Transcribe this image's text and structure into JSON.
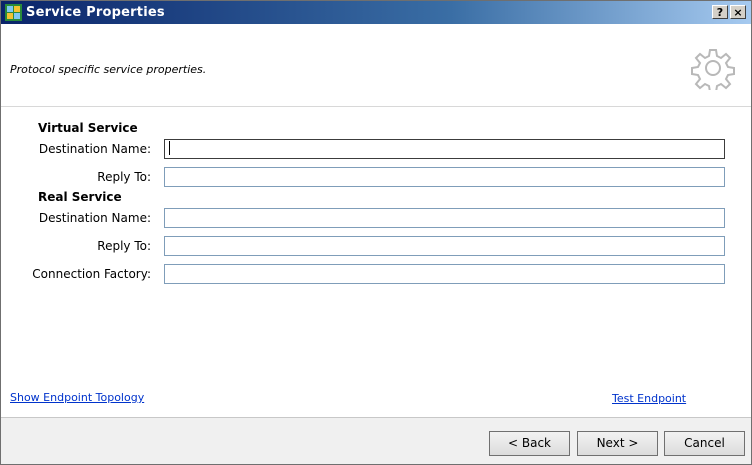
{
  "window": {
    "title": "Service Properties",
    "help_label": "?",
    "close_label": "×"
  },
  "header": {
    "subtitle": "Protocol specific service properties."
  },
  "virtual_service": {
    "heading": "Virtual Service",
    "destination_name": {
      "label": "Destination Name:",
      "value": ""
    },
    "reply_to": {
      "label": "Reply To:",
      "value": ""
    }
  },
  "real_service": {
    "heading": "Real Service",
    "destination_name": {
      "label": "Destination Name:",
      "value": ""
    },
    "reply_to": {
      "label": "Reply To:",
      "value": ""
    },
    "connection_factory": {
      "label": "Connection Factory:",
      "value": ""
    }
  },
  "links": {
    "show_topology": "Show Endpoint Topology",
    "test_endpoint": "Test Endpoint"
  },
  "buttons": {
    "back": "< Back",
    "next": "Next >",
    "cancel": "Cancel"
  },
  "colors": {
    "titlebar_start": "#0a246a",
    "titlebar_end": "#a6caf0",
    "link": "#0033cc"
  },
  "icons": {
    "app": "service-properties-icon",
    "header": "gear-icon"
  }
}
